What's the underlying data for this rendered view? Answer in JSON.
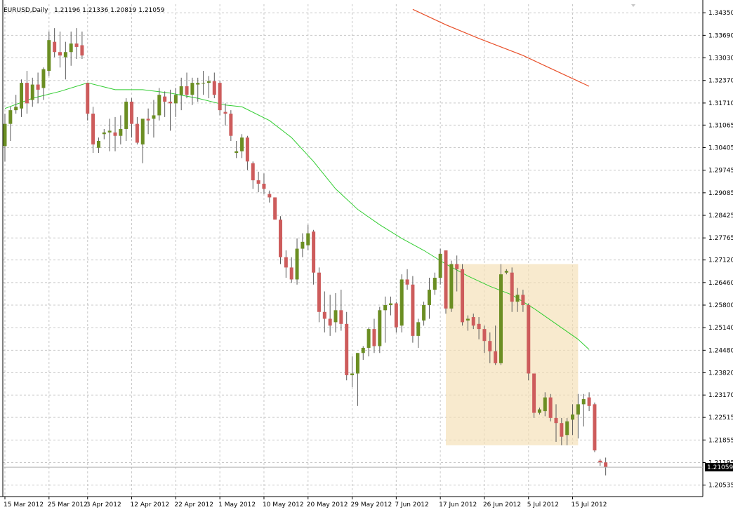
{
  "header": {
    "symbol": "EURUSD,Daily",
    "ohlc": "1.21196 1.21336 1.20819 1.21059"
  },
  "colors": {
    "bull": "#6b8e23",
    "bear": "#cd5c5c",
    "wick": "#5a5a5a",
    "ma_fast": "#32cd32",
    "ma_slow": "#e8502a",
    "zone": "#f5deb3",
    "grid": "#c8c8c8",
    "price_tag_bg": "#000000",
    "price_tag_fg": "#ffffff"
  },
  "chart_data": {
    "type": "candlestick",
    "title": "",
    "xlabel": "",
    "ylabel": "",
    "ylim": [
      1.202,
      1.346
    ],
    "grid": true,
    "y_ticks": [
      "1.34350",
      "1.33690",
      "1.33030",
      "1.32370",
      "1.31710",
      "1.31065",
      "1.30405",
      "1.29745",
      "1.29085",
      "1.28425",
      "1.27765",
      "1.27120",
      "1.26460",
      "1.25800",
      "1.25140",
      "1.24480",
      "1.23820",
      "1.23170",
      "1.22515",
      "1.21855",
      "1.21195",
      "1.20535"
    ],
    "x_tick_labels": [
      {
        "i": 0,
        "label": "15 Mar 2012"
      },
      {
        "i": 8,
        "label": "25 Mar 2012"
      },
      {
        "i": 15,
        "label": "3 Apr 2012"
      },
      {
        "i": 23,
        "label": "12 Apr 2012"
      },
      {
        "i": 31,
        "label": "22 Apr 2012"
      },
      {
        "i": 39,
        "label": "1 May 2012"
      },
      {
        "i": 47,
        "label": "10 May 2012"
      },
      {
        "i": 55,
        "label": "20 May 2012"
      },
      {
        "i": 63,
        "label": "29 May 2012"
      },
      {
        "i": 71,
        "label": "7 Jun 2012"
      },
      {
        "i": 79,
        "label": "17 Jun 2012"
      },
      {
        "i": 87,
        "label": "26 Jun 2012"
      },
      {
        "i": 95,
        "label": "5 Jul 2012"
      },
      {
        "i": 103,
        "label": "15 Jul 2012"
      }
    ],
    "candles": [
      [
        1.3045,
        1.314,
        1.3,
        1.311
      ],
      [
        1.311,
        1.316,
        1.306,
        1.315
      ],
      [
        1.315,
        1.3195,
        1.314,
        1.316
      ],
      [
        1.3155,
        1.324,
        1.313,
        1.323
      ],
      [
        1.323,
        1.3265,
        1.314,
        1.317
      ],
      [
        1.318,
        1.3245,
        1.316,
        1.3225
      ],
      [
        1.3225,
        1.326,
        1.317,
        1.321
      ],
      [
        1.3215,
        1.3275,
        1.318,
        1.327
      ],
      [
        1.3265,
        1.338,
        1.325,
        1.3355
      ],
      [
        1.335,
        1.339,
        1.3305,
        1.332
      ],
      [
        1.332,
        1.338,
        1.3275,
        1.331
      ],
      [
        1.3305,
        1.335,
        1.324,
        1.332
      ],
      [
        1.332,
        1.338,
        1.328,
        1.3345
      ],
      [
        1.3345,
        1.339,
        1.33,
        1.3335
      ],
      [
        1.334,
        1.338,
        1.33,
        1.331
      ],
      [
        1.323,
        1.323,
        1.312,
        1.314
      ],
      [
        1.314,
        1.316,
        1.3025,
        1.305
      ],
      [
        1.304,
        1.307,
        1.3025,
        1.306
      ],
      [
        1.308,
        1.3095,
        1.3065,
        1.3085
      ],
      [
        1.3085,
        1.3125,
        1.303,
        1.309
      ],
      [
        1.3085,
        1.313,
        1.303,
        1.3075
      ],
      [
        1.3075,
        1.3135,
        1.305,
        1.3095
      ],
      [
        1.3095,
        1.3185,
        1.306,
        1.3175
      ],
      [
        1.3175,
        1.3185,
        1.307,
        1.311
      ],
      [
        1.311,
        1.313,
        1.305,
        1.3055
      ],
      [
        1.305,
        1.3115,
        1.2995,
        1.3125
      ],
      [
        1.3125,
        1.3155,
        1.308,
        1.312
      ],
      [
        1.3125,
        1.318,
        1.307,
        1.3135
      ],
      [
        1.3135,
        1.3215,
        1.312,
        1.3195
      ],
      [
        1.319,
        1.3205,
        1.313,
        1.3175
      ],
      [
        1.3175,
        1.321,
        1.309,
        1.317
      ],
      [
        1.317,
        1.3215,
        1.313,
        1.3195
      ],
      [
        1.3195,
        1.3245,
        1.315,
        1.322
      ],
      [
        1.322,
        1.326,
        1.3185,
        1.3195
      ],
      [
        1.3195,
        1.3245,
        1.3165,
        1.323
      ],
      [
        1.3225,
        1.3245,
        1.3175,
        1.323
      ],
      [
        1.323,
        1.3265,
        1.3195,
        1.323
      ],
      [
        1.323,
        1.325,
        1.3185,
        1.3235
      ],
      [
        1.3235,
        1.326,
        1.3185,
        1.3195
      ],
      [
        1.323,
        1.3235,
        1.3135,
        1.315
      ],
      [
        1.3145,
        1.317,
        1.3105,
        1.314
      ],
      [
        1.314,
        1.315,
        1.306,
        1.3075
      ],
      [
        1.3025,
        1.306,
        1.301,
        1.303
      ],
      [
        1.303,
        1.308,
        1.301,
        1.307
      ],
      [
        1.307,
        1.3075,
        1.2975,
        1.3
      ],
      [
        1.2995,
        1.3,
        1.292,
        1.2945
      ],
      [
        1.2945,
        1.297,
        1.291,
        1.2935
      ],
      [
        1.2935,
        1.2965,
        1.2905,
        1.292
      ],
      [
        1.2905,
        1.2915,
        1.288,
        1.2895
      ],
      [
        1.2895,
        1.2895,
        1.283,
        1.283
      ],
      [
        1.283,
        1.284,
        1.27,
        1.272
      ],
      [
        1.272,
        1.274,
        1.266,
        1.269
      ],
      [
        1.269,
        1.272,
        1.2645,
        1.2655
      ],
      [
        1.2655,
        1.2775,
        1.264,
        1.2745
      ],
      [
        1.2745,
        1.279,
        1.272,
        1.2765
      ],
      [
        1.2755,
        1.2815,
        1.274,
        1.279
      ],
      [
        1.2795,
        1.28,
        1.264,
        1.2675
      ],
      [
        1.2675,
        1.269,
        1.253,
        1.256
      ],
      [
        1.256,
        1.262,
        1.25,
        1.254
      ],
      [
        1.254,
        1.261,
        1.249,
        1.252
      ],
      [
        1.253,
        1.2615,
        1.25,
        1.2565
      ],
      [
        1.2565,
        1.2625,
        1.2505,
        1.2525
      ],
      [
        1.2525,
        1.256,
        1.236,
        1.2375
      ],
      [
        1.2375,
        1.243,
        1.234,
        1.238
      ],
      [
        1.238,
        1.244,
        1.2285,
        1.244
      ],
      [
        1.244,
        1.246,
        1.242,
        1.2455
      ],
      [
        1.2455,
        1.2515,
        1.243,
        1.251
      ],
      [
        1.251,
        1.254,
        1.244,
        1.246
      ],
      [
        1.246,
        1.2575,
        1.244,
        1.2565
      ],
      [
        1.2565,
        1.2605,
        1.247,
        1.258
      ],
      [
        1.258,
        1.2605,
        1.255,
        1.2585
      ],
      [
        1.2585,
        1.259,
        1.25,
        1.2515
      ],
      [
        1.252,
        1.267,
        1.25,
        1.2655
      ],
      [
        1.2655,
        1.2685,
        1.2625,
        1.264
      ],
      [
        1.264,
        1.2665,
        1.247,
        1.249
      ],
      [
        1.249,
        1.254,
        1.2455,
        1.253
      ],
      [
        1.2535,
        1.259,
        1.252,
        1.258
      ],
      [
        1.258,
        1.266,
        1.254,
        1.2625
      ],
      [
        1.2625,
        1.2675,
        1.261,
        1.266
      ],
      [
        1.266,
        1.2745,
        1.264,
        1.273
      ],
      [
        1.274,
        1.274,
        1.2555,
        1.257
      ],
      [
        1.257,
        1.271,
        1.256,
        1.27
      ],
      [
        1.27,
        1.2725,
        1.262,
        1.2685
      ],
      [
        1.2685,
        1.27,
        1.252,
        1.253
      ],
      [
        1.2535,
        1.255,
        1.2505,
        1.254
      ],
      [
        1.2545,
        1.2555,
        1.251,
        1.252
      ],
      [
        1.2525,
        1.2545,
        1.248,
        1.251
      ],
      [
        1.251,
        1.252,
        1.244,
        1.2475
      ],
      [
        1.2475,
        1.25,
        1.241,
        1.2445
      ],
      [
        1.2445,
        1.252,
        1.2405,
        1.241
      ],
      [
        1.241,
        1.27,
        1.2405,
        1.267
      ],
      [
        1.2675,
        1.2685,
        1.267,
        1.268
      ],
      [
        1.2675,
        1.269,
        1.256,
        1.259
      ],
      [
        1.259,
        1.263,
        1.256,
        1.261
      ],
      [
        1.261,
        1.2625,
        1.256,
        1.258
      ],
      [
        1.258,
        1.2585,
        1.236,
        1.238
      ],
      [
        1.238,
        1.238,
        1.225,
        1.2265
      ],
      [
        1.2265,
        1.228,
        1.226,
        1.2275
      ],
      [
        1.227,
        1.2325,
        1.2255,
        1.231
      ],
      [
        1.231,
        1.232,
        1.224,
        1.225
      ],
      [
        1.225,
        1.229,
        1.218,
        1.2235
      ],
      [
        1.2235,
        1.225,
        1.217,
        1.2195
      ],
      [
        1.22,
        1.225,
        1.217,
        1.224
      ],
      [
        1.2245,
        1.229,
        1.22,
        1.226
      ],
      [
        1.226,
        1.232,
        1.219,
        1.229
      ],
      [
        1.229,
        1.232,
        1.2225,
        1.2305
      ],
      [
        1.231,
        1.2325,
        1.227,
        1.2285
      ],
      [
        1.229,
        1.2295,
        1.215,
        1.2155
      ],
      [
        1.2125,
        1.213,
        1.211,
        1.212
      ],
      [
        1.212,
        1.2134,
        1.2082,
        1.2106
      ]
    ],
    "ma_fast": [
      [
        0,
        1.3155
      ],
      [
        5,
        1.3185
      ],
      [
        10,
        1.3205
      ],
      [
        15,
        1.323
      ],
      [
        20,
        1.321
      ],
      [
        25,
        1.321
      ],
      [
        30,
        1.32
      ],
      [
        35,
        1.3185
      ],
      [
        40,
        1.3165
      ],
      [
        43,
        1.316
      ],
      [
        48,
        1.312
      ],
      [
        52,
        1.307
      ],
      [
        56,
        1.3
      ],
      [
        60,
        1.292
      ],
      [
        64,
        1.286
      ],
      [
        68,
        1.2815
      ],
      [
        72,
        1.2775
      ],
      [
        76,
        1.274
      ],
      [
        80,
        1.27
      ],
      [
        84,
        1.2665
      ],
      [
        88,
        1.2635
      ],
      [
        92,
        1.261
      ],
      [
        96,
        1.257
      ],
      [
        100,
        1.2525
      ],
      [
        104,
        1.248
      ],
      [
        106,
        1.245
      ]
    ],
    "ma_slow": [
      [
        74,
        1.3445
      ],
      [
        80,
        1.34
      ],
      [
        86,
        1.336
      ],
      [
        90,
        1.3335
      ],
      [
        94,
        1.331
      ],
      [
        98,
        1.328
      ],
      [
        102,
        1.325
      ],
      [
        106,
        1.322
      ]
    ],
    "zone": {
      "i_start": 80,
      "i_end": 104,
      "top": 1.27,
      "bottom": 1.217
    },
    "current_price": "1.21059"
  }
}
